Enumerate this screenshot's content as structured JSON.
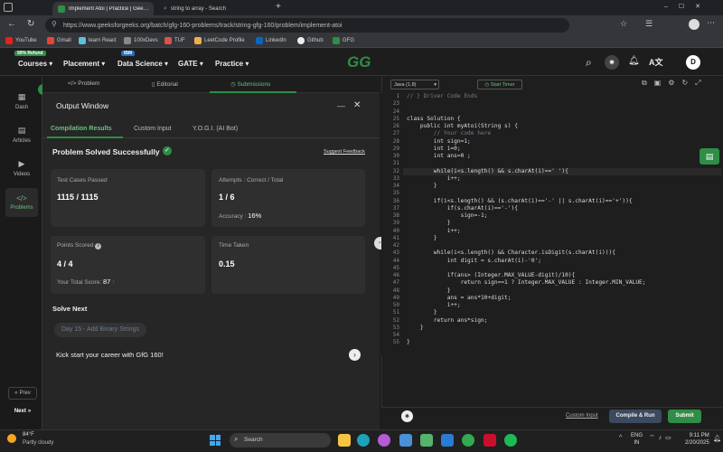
{
  "browser": {
    "tabs": [
      {
        "title": "Implement Atoi | Practice | GeeksforGeeks"
      },
      {
        "title": "string to array - Search"
      }
    ],
    "new_tab": "+",
    "url": "https://www.geeksforgeeks.org/batch/gfg-160-problems/track/string-gfg-160/problem/implement-atoi",
    "bookmarks": [
      "YouTube",
      "Gmail",
      "learn React",
      "100xDevs",
      "TUF",
      "LeetCode Profile",
      "LinkedIn",
      "Github",
      "GFG"
    ]
  },
  "header": {
    "refund_badge": "90% Refund",
    "ibm_badge": "IBM",
    "nav": [
      "Courses",
      "Placement",
      "Data Science",
      "GATE",
      "Practice"
    ],
    "logo": "GG",
    "avatar": "D"
  },
  "rail": {
    "items": [
      "Dash",
      "Articles",
      "Videos",
      "Problems"
    ],
    "prev": "Prev",
    "next": "Next"
  },
  "problem_tabs": [
    "Problem",
    "Editorial",
    "Submissions"
  ],
  "output": {
    "title": "Output Window",
    "tabs": [
      "Compilation Results",
      "Custom Input",
      "Y.O.G.I. (AI Bot)"
    ],
    "status": "Problem Solved Successfully",
    "suggest": "Suggest Feedback",
    "test_cases_label": "Test Cases Passed",
    "test_cases_value": "1115 / 1115",
    "attempts_label": "Attempts : Correct / Total",
    "attempts_value": "1 / 6",
    "accuracy_label": "Accuracy :",
    "accuracy_value": "16%",
    "points_label": "Points Scored",
    "points_value": "4 / 4",
    "total_score_label": "Your Total Score:",
    "total_score_value": "87",
    "time_label": "Time Taken",
    "time_value": "0.15",
    "solve_next": "Solve Next",
    "next_problem": "Day 15 - Add Binary Strings",
    "kickstart": "Kick start your career with GfG 160!"
  },
  "editor": {
    "language": "Java (1.8)",
    "timer": "Start Timer",
    "line_numbers": [
      "1",
      "23",
      "24",
      "25",
      "26",
      "27",
      "28",
      "29",
      "30",
      "31",
      "32",
      "33",
      "34",
      "35",
      "36",
      "37",
      "38",
      "39",
      "40",
      "41",
      "42",
      "43",
      "44",
      "45",
      "46",
      "47",
      "48",
      "49",
      "50",
      "51",
      "52",
      "53",
      "54",
      "55"
    ],
    "code_lines": [
      "// } Driver Code Ends",
      "",
      "",
      "class Solution {",
      "    public int myAtoi(String s) {",
      "        // Your code here",
      "        int sign=1;",
      "        int i=0;",
      "        int ans=0 ;",
      "",
      "        while(i<s.length() && s.charAt(i)==' '){",
      "            i++;",
      "        }",
      "",
      "        if(i<s.length() && (s.charAt(i)=='-' || s.charAt(i)=='+')){",
      "            if(s.charAt(i)=='-'){",
      "                sign=-1;",
      "            }",
      "            i++;",
      "        }",
      "",
      "        while(i<s.length() && Character.isDigit(s.charAt(i))){",
      "            int digit = s.charAt(i)-'0';",
      "",
      "            if(ans> (Integer.MAX_VALUE-digit)/10){",
      "                return sign==1 ? Integer.MAX_VALUE : Integer.MIN_VALUE;",
      "            }",
      "            ans = ans*10+digit;",
      "            i++;",
      "        }",
      "        return ans*sign;",
      "    }",
      "",
      "}"
    ],
    "custom_input": "Custom Input",
    "compile_run": "Compile & Run",
    "submit": "Submit"
  },
  "taskbar": {
    "temp": "84°F",
    "weather": "Partly cloudy",
    "search": "Search",
    "lang": "ENG",
    "region": "IN",
    "time": "9:11 PM",
    "date": "2/20/2025"
  },
  "colors": {
    "accent_green": "#2f8d46",
    "success": "#6cbf83",
    "bg": "#1e1e1e"
  }
}
